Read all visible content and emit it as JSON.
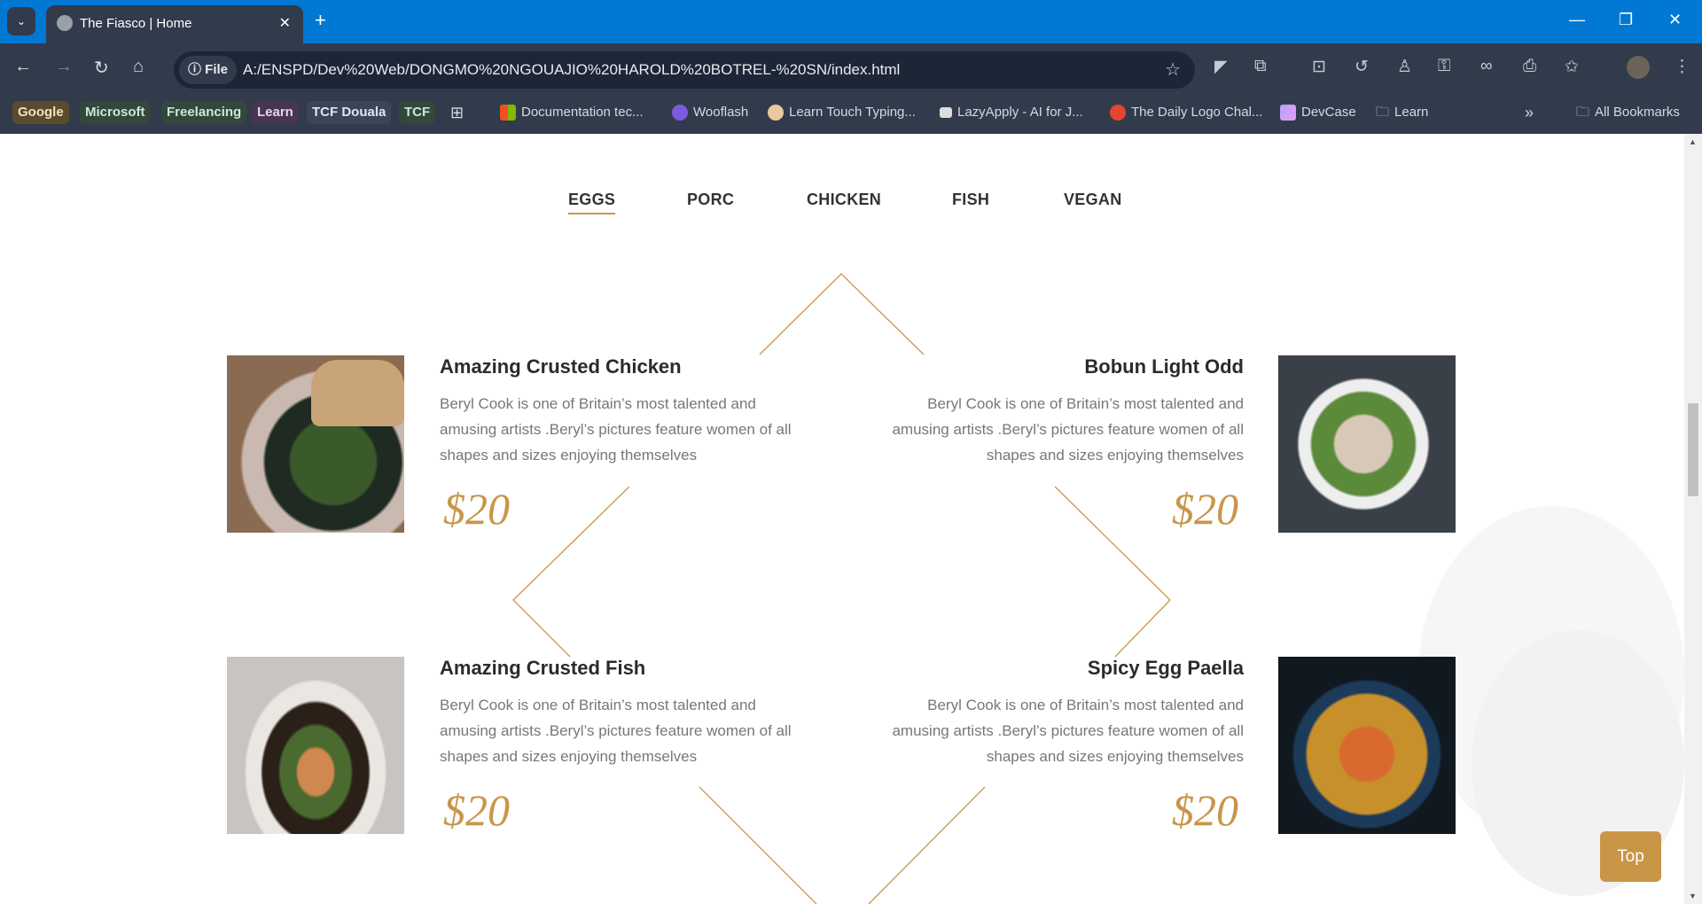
{
  "browser": {
    "tab_title": "The Fiasco | Home",
    "url_chip": "File",
    "url": "A:/ENSPD/Dev%20Web/DONGMO%20NGOUAJIO%20HAROLD%20BOTREL-%20SN/index.html",
    "bookmarks": [
      "Google",
      "Microsoft",
      "Freelancing",
      "Learn",
      "TCF Douala",
      "TCF"
    ],
    "bookmark_links": [
      "Documentation tec...",
      "Wooflash",
      "Learn Touch Typing...",
      "LazyApply - AI for J...",
      "The Daily Logo Chal...",
      "DevCase",
      "Learn"
    ],
    "all_bookmarks": "All Bookmarks"
  },
  "menu": {
    "tabs": [
      "EGGS",
      "PORC",
      "CHICKEN",
      "FISH",
      "VEGAN"
    ],
    "active": "EGGS"
  },
  "items": [
    {
      "title": "Amazing Crusted Chicken",
      "desc": "Beryl Cook is one of Britain’s most talented and amusing artists .Beryl’s pictures feature women of all shapes and sizes enjoying themselves",
      "price": "$20"
    },
    {
      "title": "Bobun Light Odd",
      "desc": "Beryl Cook is one of Britain’s most talented and amusing artists .Beryl’s pictures feature women of all shapes and sizes enjoying themselves",
      "price": "$20"
    },
    {
      "title": "Amazing Crusted Fish",
      "desc": "Beryl Cook is one of Britain’s most talented and amusing artists .Beryl’s pictures feature women of all shapes and sizes enjoying themselves",
      "price": "$20"
    },
    {
      "title": "Spicy Egg Paella",
      "desc": "Beryl Cook is one of Britain’s most talented and amusing artists .Beryl’s pictures feature women of all shapes and sizes enjoying themselves",
      "price": "$20"
    }
  ],
  "top_button": "Top",
  "colors": {
    "accent": "#c89646",
    "browser_blue": "#0078d4",
    "toolbar": "#323b4b"
  }
}
